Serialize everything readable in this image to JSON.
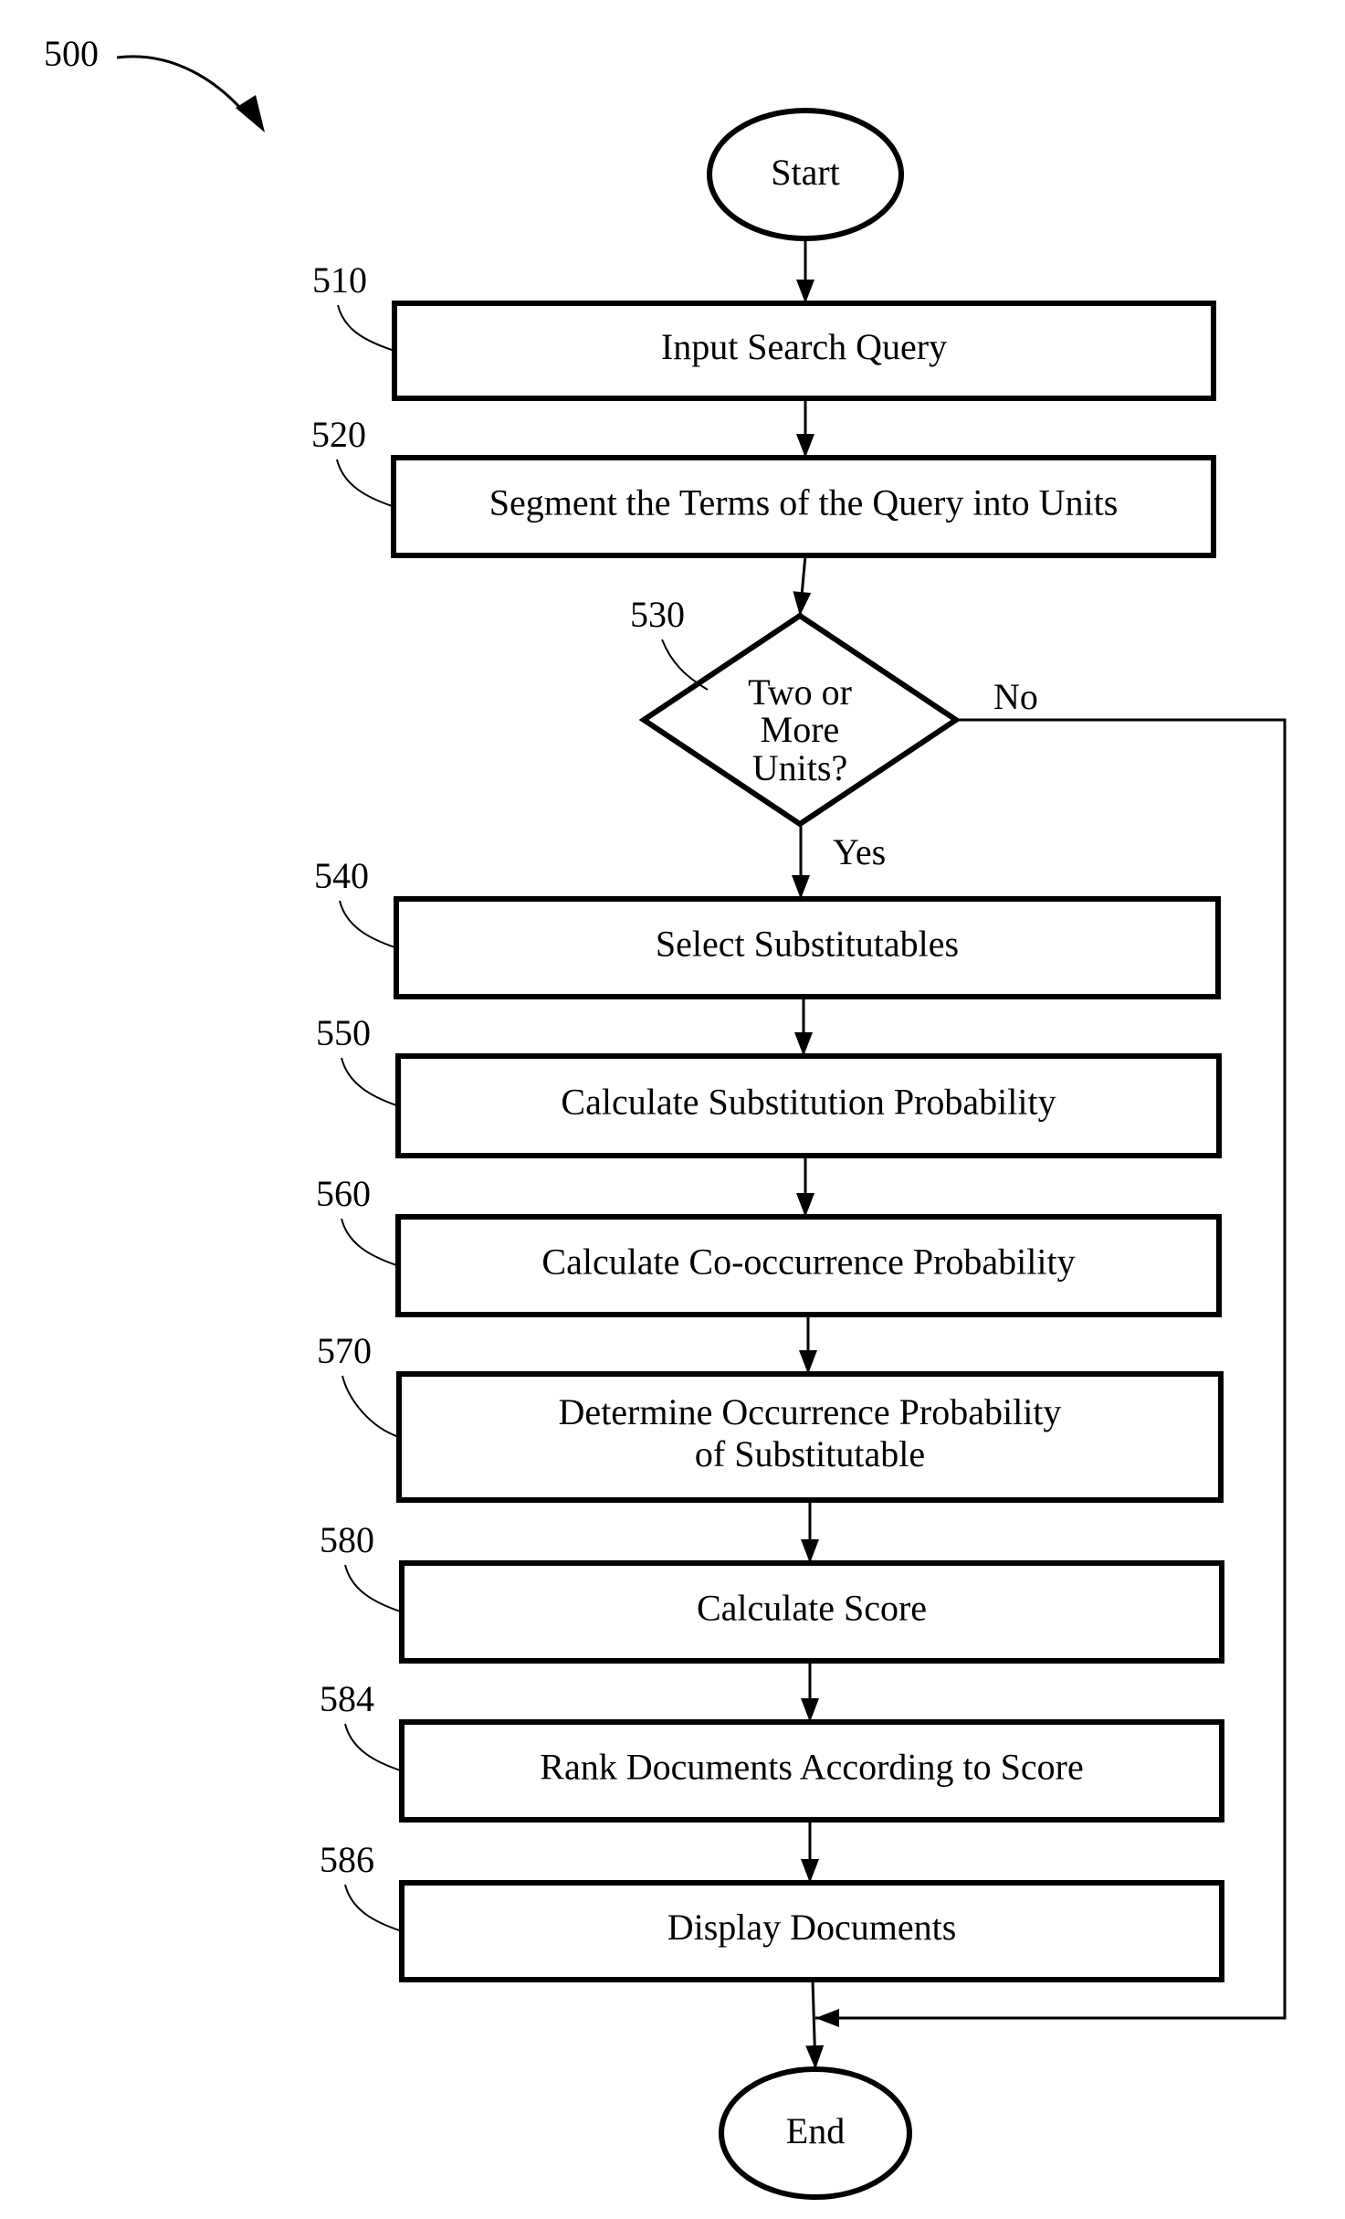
{
  "figure": {
    "ref": "500",
    "start_label": "Start",
    "end_label": "End",
    "steps": [
      {
        "ref": "510",
        "text": [
          "Input Search Query"
        ]
      },
      {
        "ref": "520",
        "text": [
          "Segment the Terms of the Query into Units"
        ]
      },
      {
        "ref": "540",
        "text": [
          "Select Substitutables"
        ]
      },
      {
        "ref": "550",
        "text": [
          "Calculate Substitution Probability"
        ]
      },
      {
        "ref": "560",
        "text": [
          "Calculate Co-occurrence Probability"
        ]
      },
      {
        "ref": "570",
        "text": [
          "Determine Occurrence Probability",
          "of Substitutable"
        ]
      },
      {
        "ref": "580",
        "text": [
          "Calculate Score"
        ]
      },
      {
        "ref": "584",
        "text": [
          "Rank Documents According to Score"
        ]
      },
      {
        "ref": "586",
        "text": [
          "Display Documents"
        ]
      }
    ],
    "decision": {
      "ref": "530",
      "text": [
        "Two or",
        "More",
        "Units?"
      ],
      "yes_label": "Yes",
      "no_label": "No"
    }
  }
}
